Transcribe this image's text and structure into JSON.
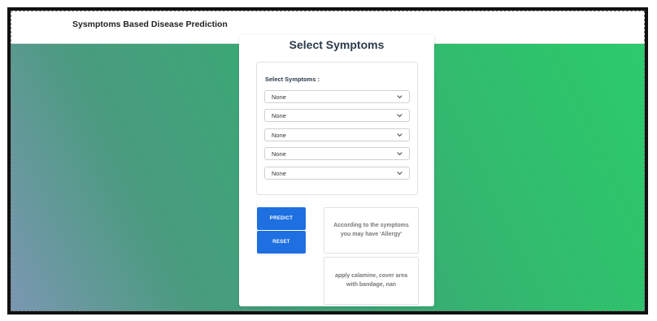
{
  "header": {
    "title": "Sysmptoms Based Disease Prediction"
  },
  "card": {
    "title": "Select Symptoms",
    "select_label": "Select Symptoms :",
    "dropdowns": [
      {
        "value": "None",
        "icon": "chevron-down-icon"
      },
      {
        "value": "None",
        "icon": "chevron-down-icon"
      },
      {
        "value": "None",
        "icon": "chevron-down-icon"
      },
      {
        "value": "None",
        "icon": "chevron-down-icon"
      },
      {
        "value": "None",
        "icon": "chevron-down-icon"
      }
    ]
  },
  "actions": {
    "predict_label": "PREDICT",
    "reset_label": "RESET"
  },
  "result": {
    "prediction_text": "According to the symptoms you may have 'Allergy'",
    "treatment_text": "apply calamine, cover area with bandage, nan"
  },
  "colors": {
    "button": "#1e6fe0",
    "gradient_start": "#7b97b2",
    "gradient_end": "#2ccb6c"
  }
}
